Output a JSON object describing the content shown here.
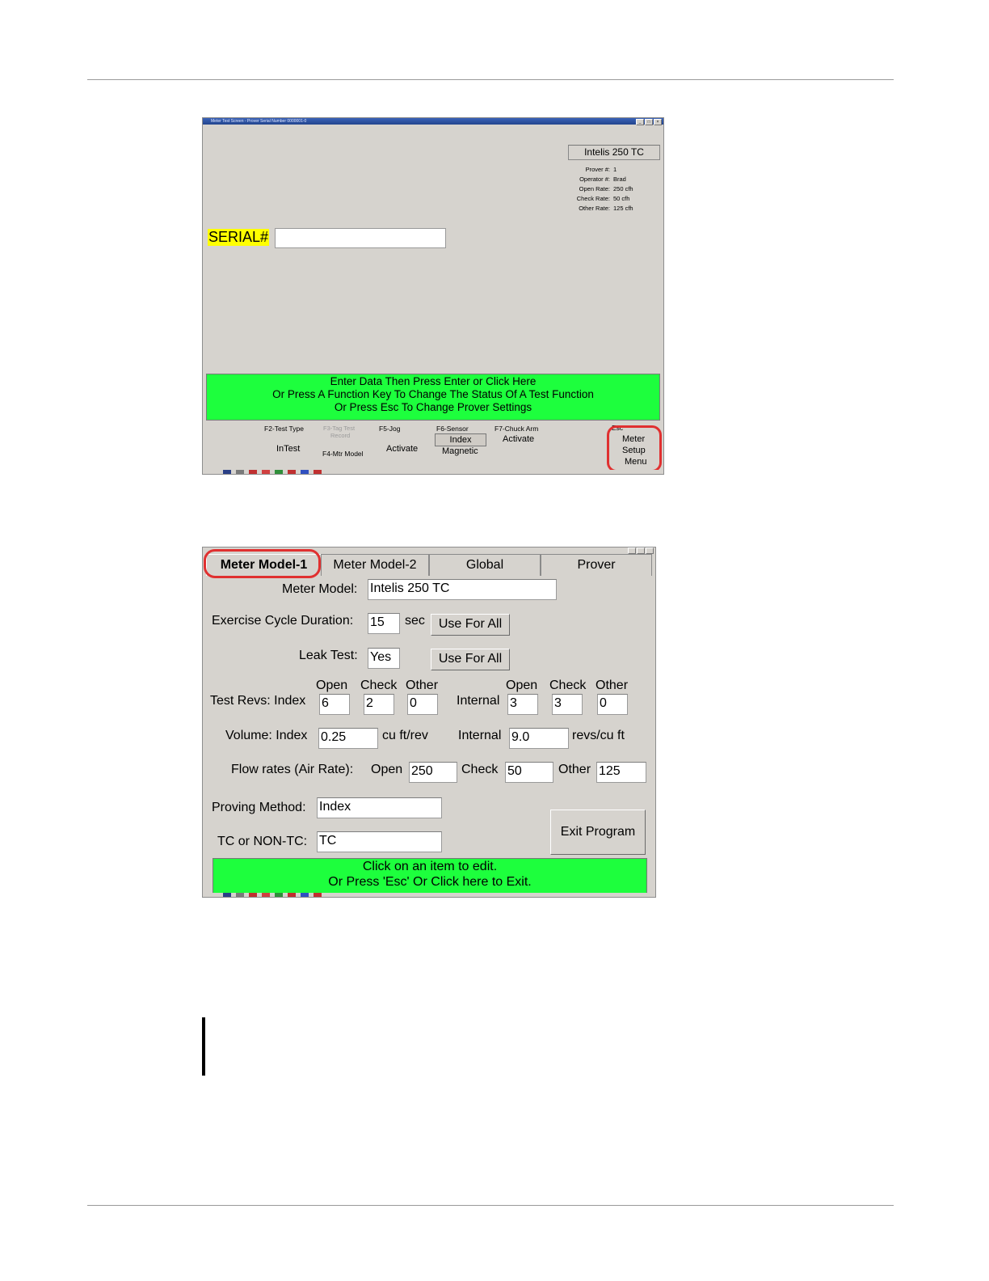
{
  "screen1": {
    "title": "Meter Test Screen - Prover Serial Number 0000001-0",
    "meter_model": "Intelis 250 TC",
    "info": [
      {
        "label": "Prover #:",
        "value": "1"
      },
      {
        "label": "Operator #:",
        "value": "Brad"
      },
      {
        "label": "Open Rate:",
        "value": "250 cfh"
      },
      {
        "label": "Check Rate:",
        "value": "50 cfh"
      },
      {
        "label": "Other Rate:",
        "value": "125 cfh"
      }
    ],
    "serial_label": "SERIAL#",
    "serial_value": "",
    "green_lines": [
      "Enter Data Then Press Enter or Click Here",
      "Or Press A Function Key To Change The Status Of A Test Function",
      "Or Press Esc To Change Prover Settings"
    ],
    "fkeys": {
      "f2_label": "F2-Test Type",
      "f2_value": "InTest",
      "f3_label": "F3-Tag Test",
      "f3_label2": "Record",
      "f4_label": "F4-Mtr Model",
      "f5_label": "F5-Jog",
      "f5_value": "Activate",
      "f6_label": "F6-Sensor",
      "f6_value": "Index",
      "f6_value2": "Magnetic",
      "f7_label": "F7-Chuck Arm",
      "f7_value": "Activate",
      "esc_label": "Esc",
      "esc_line1": "Meter",
      "esc_line2": "Setup",
      "esc_line3": "Menu"
    },
    "highlight_color": "#e03030",
    "green_color": "#1dff3d",
    "serial_bg": "#ffff00"
  },
  "screen2": {
    "tabs": [
      "Meter Model-1",
      "Meter Model-2",
      "Global",
      "Prover"
    ],
    "active_tab": "Meter Model-1",
    "meter_model_label": "Meter Model:",
    "meter_model_value": "Intelis 250 TC",
    "exercise_label": "Exercise Cycle Duration:",
    "exercise_value": "15",
    "exercise_unit": "sec",
    "use_for_all": "Use For All",
    "leak_label": "Leak Test:",
    "leak_value": "Yes",
    "col_open": "Open",
    "col_check": "Check",
    "col_other": "Other",
    "test_revs_label": "Test Revs: Index",
    "test_revs_index": [
      "6",
      "2",
      "0"
    ],
    "internal_label": "Internal",
    "test_revs_internal": [
      "3",
      "3",
      "0"
    ],
    "volume_label": "Volume: Index",
    "volume_index": "0.25",
    "volume_index_unit": "cu ft/rev",
    "volume_internal": "9.0",
    "volume_internal_unit": "revs/cu ft",
    "flow_label": "Flow rates (Air Rate):",
    "flow_open_label": "Open",
    "flow_open": "250",
    "flow_check_label": "Check",
    "flow_check": "50",
    "flow_other_label": "Other",
    "flow_other": "125",
    "proving_label": "Proving Method:",
    "proving_value": "Index",
    "tc_label": "TC or NON-TC:",
    "tc_value": "TC",
    "exit_button": "Exit Program",
    "green_line1": "Click on an item to edit.",
    "green_line2": "Or Press 'Esc' Or Click here to Exit."
  }
}
